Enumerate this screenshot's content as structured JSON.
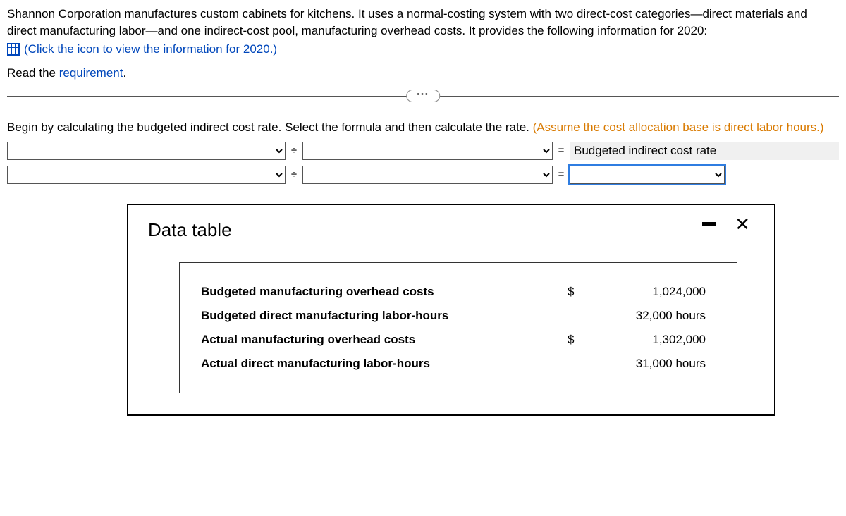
{
  "problem": {
    "text": "Shannon Corporation manufactures custom cabinets for kitchens. It uses a normal-costing system with two direct-cost categories—direct materials and direct manufacturing labor—and one indirect-cost pool, manufacturing overhead costs. It provides the following information for 2020:",
    "info_prefix": "(Click the icon to view the information for ",
    "info_year": "2020",
    "info_suffix": ".)",
    "read_prefix": "Read the ",
    "read_link": "requirement",
    "read_suffix": "."
  },
  "instruction": {
    "main": "Begin by calculating the budgeted indirect cost rate. Select the formula and then calculate the rate. ",
    "note": "(Assume the cost allocation base is direct labor hours.)"
  },
  "formula": {
    "divide": "÷",
    "equals": "=",
    "result_label": "Budgeted indirect cost rate"
  },
  "modal": {
    "title": "Data table",
    "rows": [
      {
        "label": "Budgeted manufacturing overhead costs",
        "currency": "$",
        "value": "1,024,000"
      },
      {
        "label": "Budgeted direct manufacturing labor-hours",
        "currency": "",
        "value": "32,000 hours"
      },
      {
        "label": "Actual manufacturing overhead costs",
        "currency": "$",
        "value": "1,302,000"
      },
      {
        "label": "Actual direct manufacturing labor-hours",
        "currency": "",
        "value": "31,000 hours"
      }
    ]
  }
}
